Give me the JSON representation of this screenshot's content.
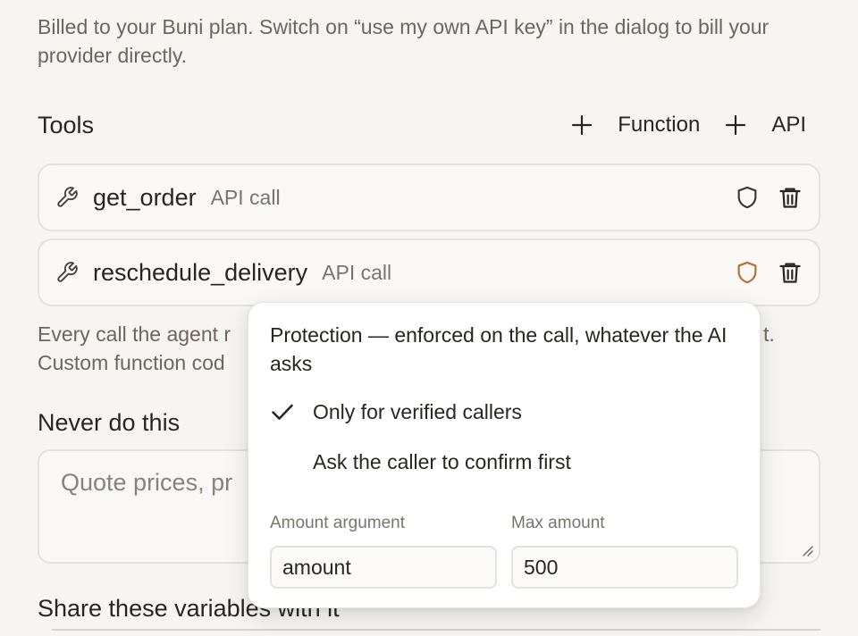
{
  "billing_note": "Billed to your Buni plan. Switch on “use my own API key” in the dialog to bill your provider directly.",
  "tools": {
    "title": "Tools",
    "add_function_label": "Function",
    "add_api_label": "API",
    "items": [
      {
        "name": "get_order",
        "type": "API call",
        "protected": false
      },
      {
        "name": "reschedule_delivery",
        "type": "API call",
        "protected": true
      }
    ]
  },
  "calls_note": {
    "line1_left": "Every call the agent r",
    "line1_right": "t.",
    "line2_left": "Custom function cod"
  },
  "never": {
    "title": "Never do this",
    "placeholder_visible": "Quote prices, pr"
  },
  "share": {
    "title": "Share these variables with it"
  },
  "popover": {
    "title": "Protection — enforced on the call, whatever the AI asks",
    "options": [
      {
        "label": "Only for verified callers",
        "checked": true
      },
      {
        "label": "Ask the caller to confirm first",
        "checked": false
      }
    ],
    "amount_argument": {
      "label": "Amount argument",
      "value": "amount"
    },
    "max_amount": {
      "label": "Max amount",
      "value": "500"
    }
  },
  "colors": {
    "background": "#f7f5f2",
    "text": "#2a2522",
    "muted": "#6e655e",
    "border": "#e6e1da",
    "shield_active": "#b8722e",
    "shield_inactive": "#3a3430"
  }
}
